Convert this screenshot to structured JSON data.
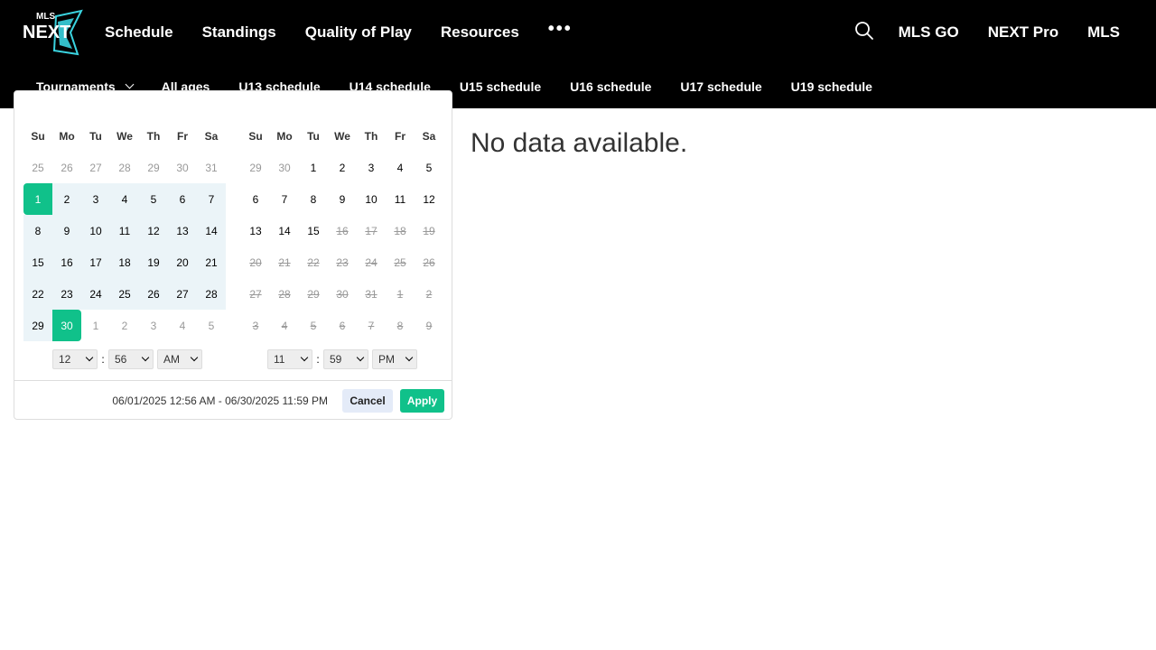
{
  "brand": {
    "logo_top_text": "MLS",
    "logo_main_text": "NEXT",
    "logo_accent": "#3ad3df"
  },
  "main_nav": {
    "items": [
      {
        "label": "Schedule"
      },
      {
        "label": "Standings"
      },
      {
        "label": "Quality of Play"
      },
      {
        "label": "Resources"
      }
    ],
    "more_label": "•••"
  },
  "right_nav": {
    "search_icon": "search-icon",
    "items": [
      {
        "label": "MLS GO"
      },
      {
        "label": "NEXT Pro"
      },
      {
        "label": "MLS"
      }
    ]
  },
  "sub_nav": {
    "items": [
      {
        "label": "Tournaments",
        "dropdown": true
      },
      {
        "label": "All ages"
      },
      {
        "label": "U13 schedule",
        "active": true
      },
      {
        "label": "U14 schedule"
      },
      {
        "label": "U15 schedule"
      },
      {
        "label": "U16 schedule"
      },
      {
        "label": "U17 schedule"
      },
      {
        "label": "U19 schedule"
      }
    ]
  },
  "picker": {
    "weekdays": [
      "Su",
      "Mo",
      "Tu",
      "We",
      "Th",
      "Fr",
      "Sa"
    ],
    "left_calendar": {
      "weeks": [
        [
          {
            "d": "25",
            "s": "off"
          },
          {
            "d": "26",
            "s": "off"
          },
          {
            "d": "27",
            "s": "off"
          },
          {
            "d": "28",
            "s": "off"
          },
          {
            "d": "29",
            "s": "off"
          },
          {
            "d": "30",
            "s": "off"
          },
          {
            "d": "31",
            "s": "off"
          }
        ],
        [
          {
            "d": "1",
            "s": "start"
          },
          {
            "d": "2",
            "s": "in"
          },
          {
            "d": "3",
            "s": "in"
          },
          {
            "d": "4",
            "s": "in"
          },
          {
            "d": "5",
            "s": "in"
          },
          {
            "d": "6",
            "s": "in"
          },
          {
            "d": "7",
            "s": "in"
          }
        ],
        [
          {
            "d": "8",
            "s": "in"
          },
          {
            "d": "9",
            "s": "in"
          },
          {
            "d": "10",
            "s": "in"
          },
          {
            "d": "11",
            "s": "in"
          },
          {
            "d": "12",
            "s": "in"
          },
          {
            "d": "13",
            "s": "in"
          },
          {
            "d": "14",
            "s": "in"
          }
        ],
        [
          {
            "d": "15",
            "s": "in"
          },
          {
            "d": "16",
            "s": "in"
          },
          {
            "d": "17",
            "s": "in"
          },
          {
            "d": "18",
            "s": "in"
          },
          {
            "d": "19",
            "s": "in"
          },
          {
            "d": "20",
            "s": "in"
          },
          {
            "d": "21",
            "s": "in"
          }
        ],
        [
          {
            "d": "22",
            "s": "in"
          },
          {
            "d": "23",
            "s": "in"
          },
          {
            "d": "24",
            "s": "in"
          },
          {
            "d": "25",
            "s": "in"
          },
          {
            "d": "26",
            "s": "in"
          },
          {
            "d": "27",
            "s": "in"
          },
          {
            "d": "28",
            "s": "in"
          }
        ],
        [
          {
            "d": "29",
            "s": "in"
          },
          {
            "d": "30",
            "s": "end"
          },
          {
            "d": "1",
            "s": "off"
          },
          {
            "d": "2",
            "s": "off"
          },
          {
            "d": "3",
            "s": "off"
          },
          {
            "d": "4",
            "s": "off"
          },
          {
            "d": "5",
            "s": "off"
          }
        ]
      ],
      "time": {
        "hour": "12",
        "minute": "56",
        "ampm": "AM"
      }
    },
    "right_calendar": {
      "weeks": [
        [
          {
            "d": "29",
            "s": "off"
          },
          {
            "d": "30",
            "s": "off"
          },
          {
            "d": "1",
            "s": ""
          },
          {
            "d": "2",
            "s": ""
          },
          {
            "d": "3",
            "s": ""
          },
          {
            "d": "4",
            "s": ""
          },
          {
            "d": "5",
            "s": ""
          }
        ],
        [
          {
            "d": "6",
            "s": ""
          },
          {
            "d": "7",
            "s": ""
          },
          {
            "d": "8",
            "s": ""
          },
          {
            "d": "9",
            "s": ""
          },
          {
            "d": "10",
            "s": ""
          },
          {
            "d": "11",
            "s": ""
          },
          {
            "d": "12",
            "s": ""
          }
        ],
        [
          {
            "d": "13",
            "s": ""
          },
          {
            "d": "14",
            "s": ""
          },
          {
            "d": "15",
            "s": ""
          },
          {
            "d": "16",
            "s": "disabled"
          },
          {
            "d": "17",
            "s": "disabled"
          },
          {
            "d": "18",
            "s": "disabled"
          },
          {
            "d": "19",
            "s": "disabled"
          }
        ],
        [
          {
            "d": "20",
            "s": "disabled"
          },
          {
            "d": "21",
            "s": "disabled"
          },
          {
            "d": "22",
            "s": "disabled"
          },
          {
            "d": "23",
            "s": "disabled"
          },
          {
            "d": "24",
            "s": "disabled"
          },
          {
            "d": "25",
            "s": "disabled"
          },
          {
            "d": "26",
            "s": "disabled"
          }
        ],
        [
          {
            "d": "27",
            "s": "disabled"
          },
          {
            "d": "28",
            "s": "disabled"
          },
          {
            "d": "29",
            "s": "disabled"
          },
          {
            "d": "30",
            "s": "disabled"
          },
          {
            "d": "31",
            "s": "disabled"
          },
          {
            "d": "1",
            "s": "disabled"
          },
          {
            "d": "2",
            "s": "disabled"
          }
        ],
        [
          {
            "d": "3",
            "s": "disabled"
          },
          {
            "d": "4",
            "s": "disabled"
          },
          {
            "d": "5",
            "s": "disabled"
          },
          {
            "d": "6",
            "s": "disabled"
          },
          {
            "d": "7",
            "s": "disabled"
          },
          {
            "d": "8",
            "s": "disabled"
          },
          {
            "d": "9",
            "s": "disabled"
          }
        ]
      ],
      "time": {
        "hour": "11",
        "minute": "59",
        "ampm": "PM"
      }
    },
    "time_colon": ":",
    "range_text": "06/01/2025 12:56 AM - 06/30/2025 11:59 PM",
    "cancel_label": "Cancel",
    "apply_label": "Apply",
    "colors": {
      "selected": "#10c18a",
      "in_range": "#ebf4f8",
      "cancel_bg": "#e4ebf8"
    }
  },
  "main": {
    "empty_message": "No data available."
  }
}
